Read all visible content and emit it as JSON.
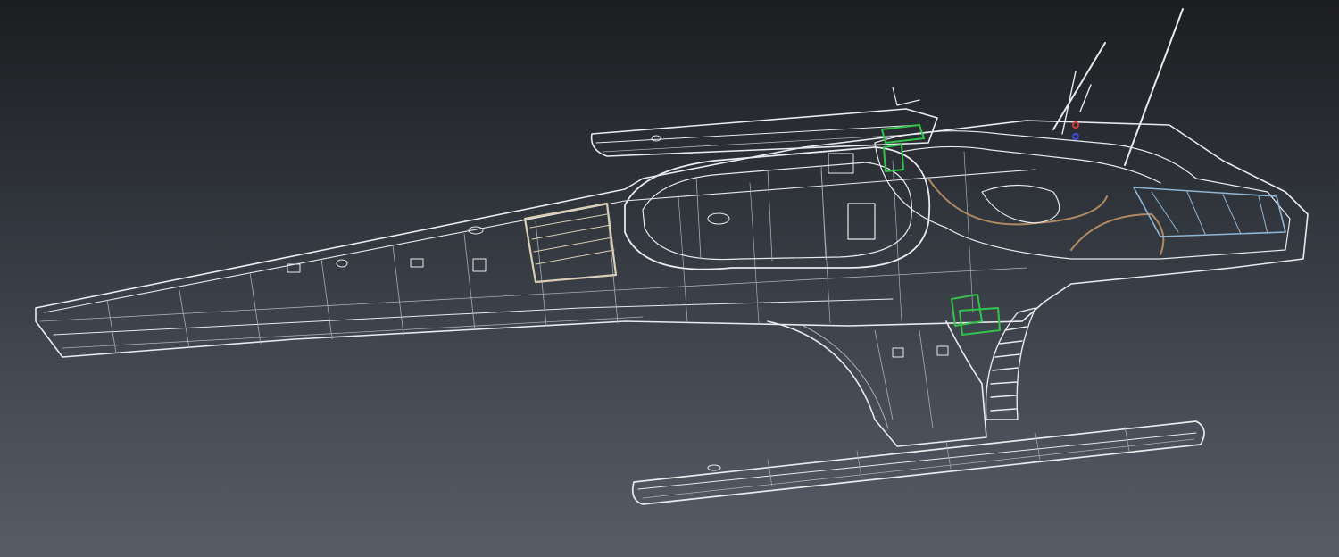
{
  "scene": {
    "subject": "trimaran-wireframe",
    "background": {
      "top": "#1c1d20",
      "bottom": "#565d66"
    },
    "colors": {
      "wire": "#e8eaee",
      "wire_dim": "#a9aeb6",
      "highlight_green": "#33c24a",
      "cabin_beige": "#d9cfb5",
      "tube_copper": "#b08a63",
      "rigging_blue": "#8fb6d6",
      "marker_red": "#d23a3a",
      "marker_blue": "#3b4fd6"
    },
    "icons": [
      "hull-wireframe",
      "float-wireframe",
      "mast-icon",
      "foil-icon"
    ]
  }
}
